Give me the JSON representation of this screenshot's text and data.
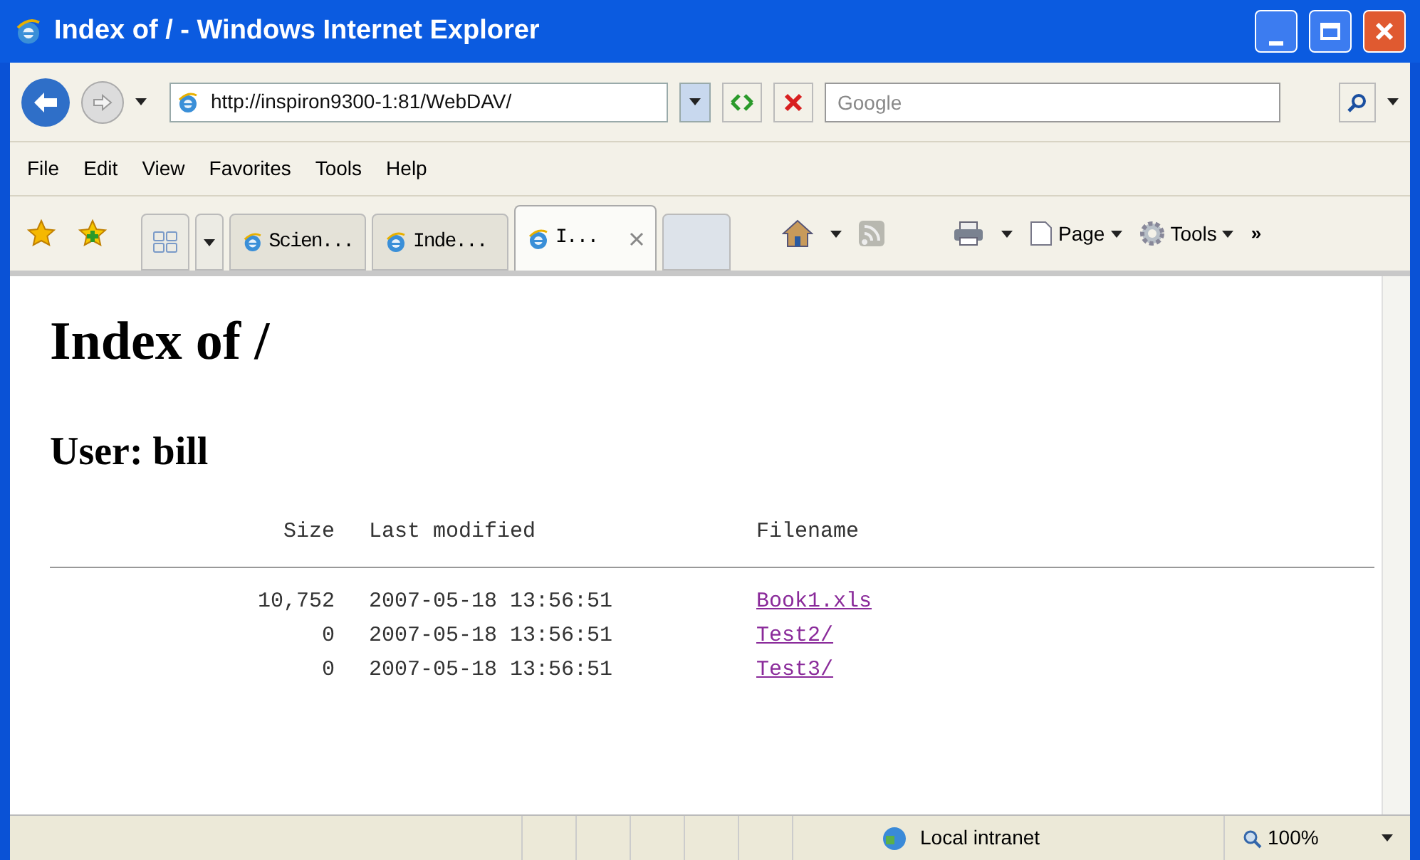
{
  "window": {
    "title": "Index of / - Windows Internet Explorer"
  },
  "address_bar": {
    "value": "http://inspiron9300-1:81/WebDAV/"
  },
  "search": {
    "placeholder": "Google"
  },
  "menu": [
    "File",
    "Edit",
    "View",
    "Favorites",
    "Tools",
    "Help"
  ],
  "tabs": [
    {
      "label": "Scien...",
      "selected": false
    },
    {
      "label": "Inde...",
      "selected": false
    },
    {
      "label": "I...",
      "selected": true
    }
  ],
  "command_bar": {
    "page": "Page",
    "tools": "Tools",
    "more": "»"
  },
  "page": {
    "heading": "Index of /",
    "subheading": "User: bill",
    "columns": [
      "Size",
      "Last modified",
      "Filename"
    ],
    "rows": [
      {
        "size": "10,752",
        "modified": "2007-05-18 13:56:51",
        "filename": "Book1.xls"
      },
      {
        "size": "0",
        "modified": "2007-05-18 13:56:51",
        "filename": "Test2/"
      },
      {
        "size": "0",
        "modified": "2007-05-18 13:56:51",
        "filename": "Test3/"
      }
    ]
  },
  "status_bar": {
    "zone": "Local intranet",
    "zoom": "100%"
  }
}
